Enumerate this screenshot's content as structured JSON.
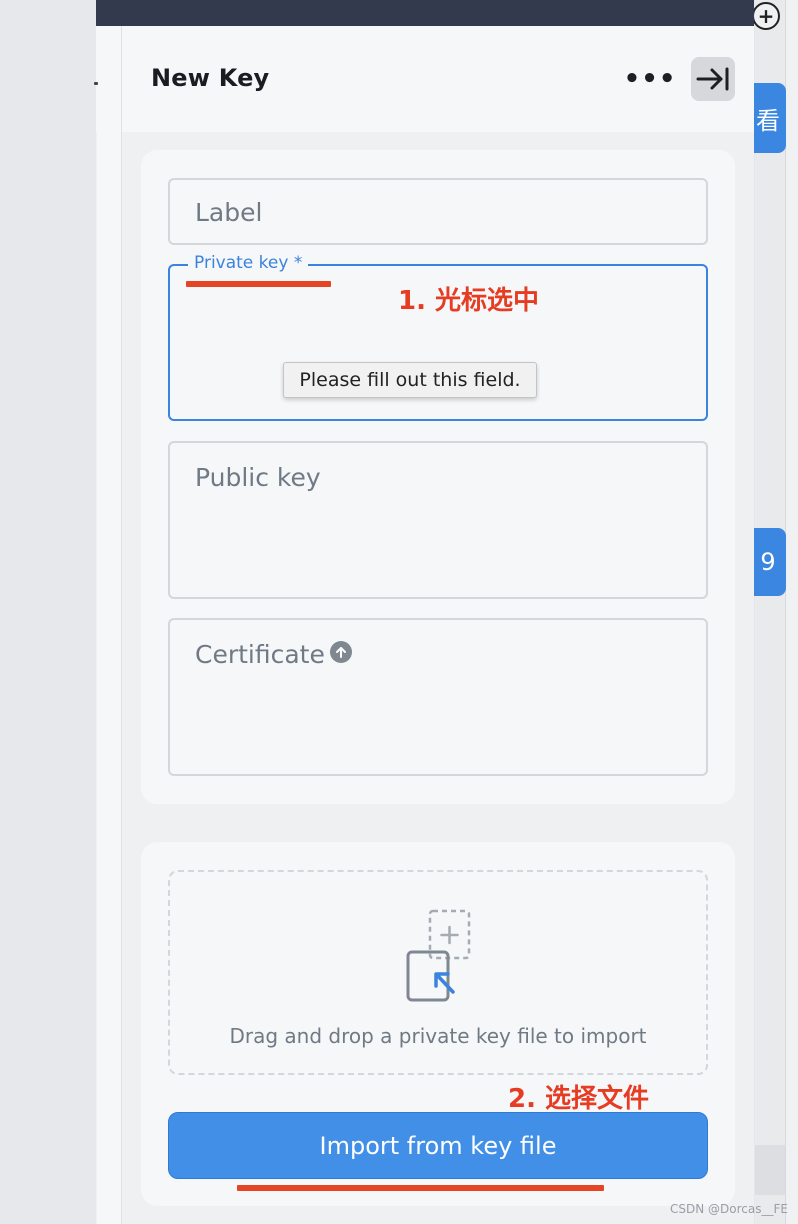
{
  "header": {
    "title": "New Key",
    "more_label": "•••"
  },
  "form": {
    "label_placeholder": "Label",
    "private_key_label": "Private key *",
    "validation_tooltip": "Please fill out this field.",
    "public_key_placeholder": "Public key",
    "certificate_placeholder": "Certificate"
  },
  "import": {
    "dropzone_text": "Drag and drop a private key file to import",
    "button_label": "Import from key file"
  },
  "annotations": {
    "step1": "1. 光标选中",
    "step2": "2. 选择文件",
    "color": "#e63c22"
  },
  "background": {
    "plus_label": "+",
    "side_button_1": "看",
    "side_button_2": "9"
  },
  "watermark": "CSDN @Dorcas__FE",
  "colors": {
    "accent": "#3a83de",
    "button": "#418fe7",
    "topbar": "#333a4e"
  }
}
